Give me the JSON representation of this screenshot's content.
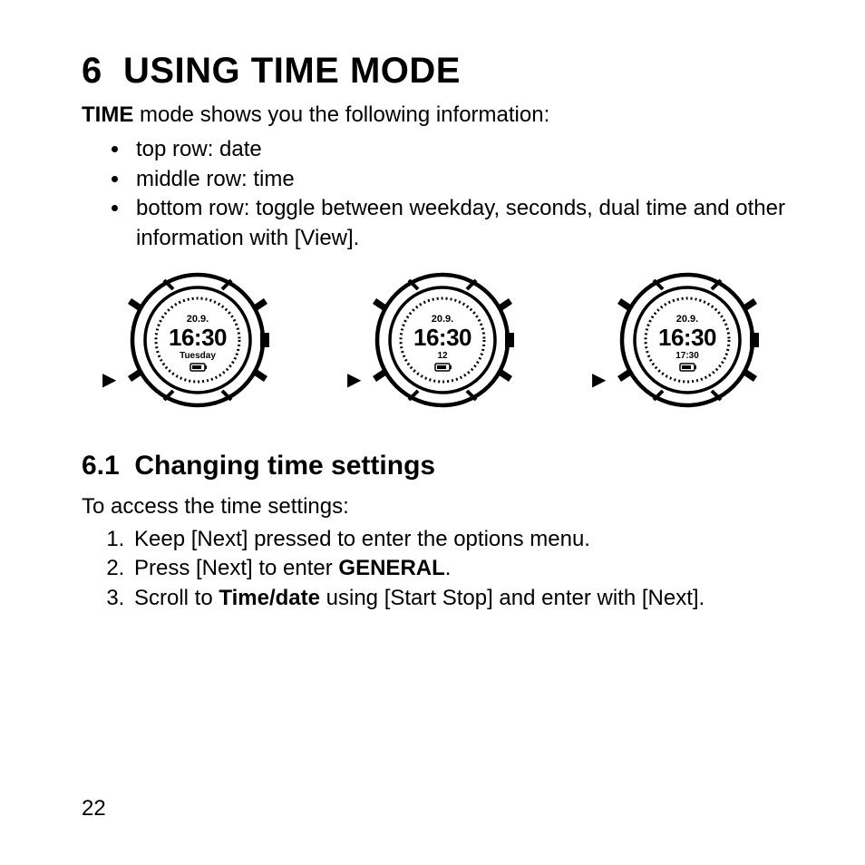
{
  "chapter": {
    "number": "6",
    "title": "USING TIME MODE"
  },
  "intro": {
    "mode_name": "TIME",
    "sentence_rest": " mode shows you the following information:"
  },
  "rows": {
    "top": "top row: date",
    "middle": "middle row: time",
    "bottom": "bottom row: toggle between weekday, seconds, dual time and other information with [View]."
  },
  "watches": [
    {
      "date": "20.9.",
      "time": "16:30",
      "bottom": "Tuesday"
    },
    {
      "date": "20.9.",
      "time": "16:30",
      "bottom": "12"
    },
    {
      "date": "20.9.",
      "time": "16:30",
      "bottom": "17:30"
    }
  ],
  "pointer_glyph": "▶",
  "section": {
    "number": "6.1",
    "title": "Changing time settings"
  },
  "lead": "To access the time settings:",
  "steps": {
    "s1": "Keep [Next] pressed to enter the options menu.",
    "s2_a": "Press [Next] to enter ",
    "s2_b": "GENERAL",
    "s2_c": ".",
    "s3_a": "Scroll to ",
    "s3_b": "Time/date",
    "s3_c": " using [Start Stop] and enter with [Next]."
  },
  "page_number": "22"
}
